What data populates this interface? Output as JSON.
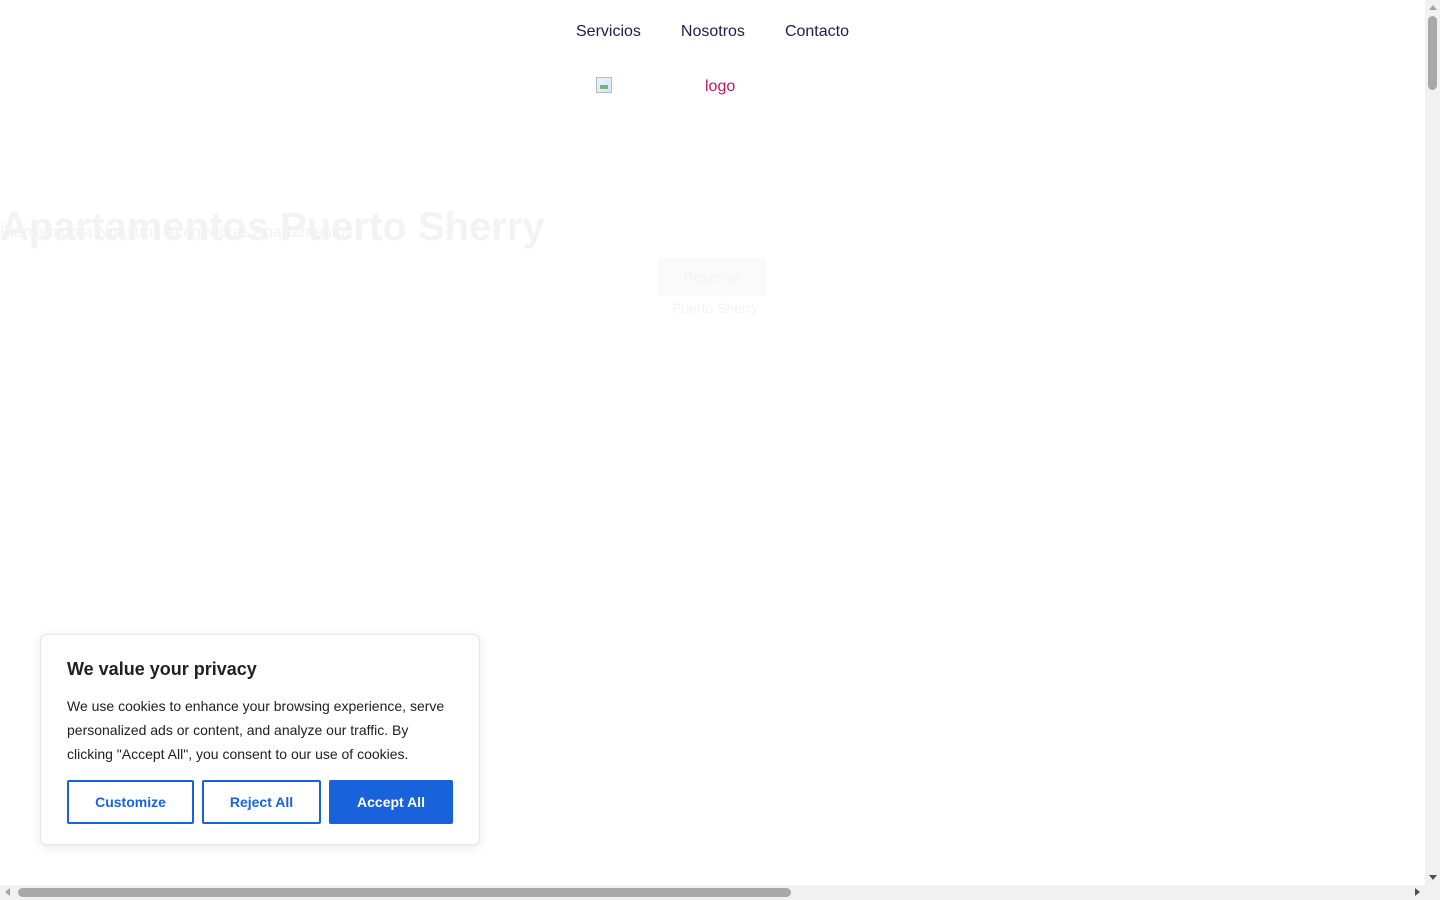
{
  "nav": {
    "items": [
      {
        "label": "Servicios"
      },
      {
        "label": "Nosotros"
      },
      {
        "label": "Contacto"
      }
    ]
  },
  "logo": {
    "alt_text": "logo"
  },
  "hero": {
    "title": "Apartamentos Puerto Sherry",
    "subtitle": "Bienvenido a Nuestros Acogedores Apartamentos",
    "cta_label": "Reservar",
    "location": "Puerto Sherry"
  },
  "cookie_banner": {
    "title": "We value your privacy",
    "text": "We use cookies to enhance your browsing experience, serve personalized ads or content, and analyze our traffic. By clicking \"Accept All\", you consent to our use of cookies.",
    "customize_label": "Customize",
    "reject_label": "Reject All",
    "accept_label": "Accept All"
  },
  "colors": {
    "nav_text": "#1b1f4a",
    "logo_alt": "#c2185b",
    "accent": "#1863dc"
  }
}
